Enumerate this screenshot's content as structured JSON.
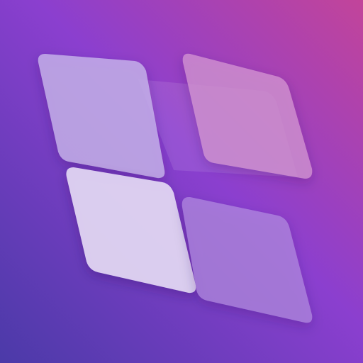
{
  "icon": {
    "name": "four-tile-grid-logo",
    "background_colors": {
      "top_right": "#c2449a",
      "middle": "#8b3fcf",
      "bottom_left": "#4b3aa8"
    },
    "tile_colors": {
      "top_left": "#c6b2ea",
      "top_right": "#d79ad4",
      "bottom_left": "#e2d6f3",
      "bottom_right": "#b28ae0"
    }
  }
}
